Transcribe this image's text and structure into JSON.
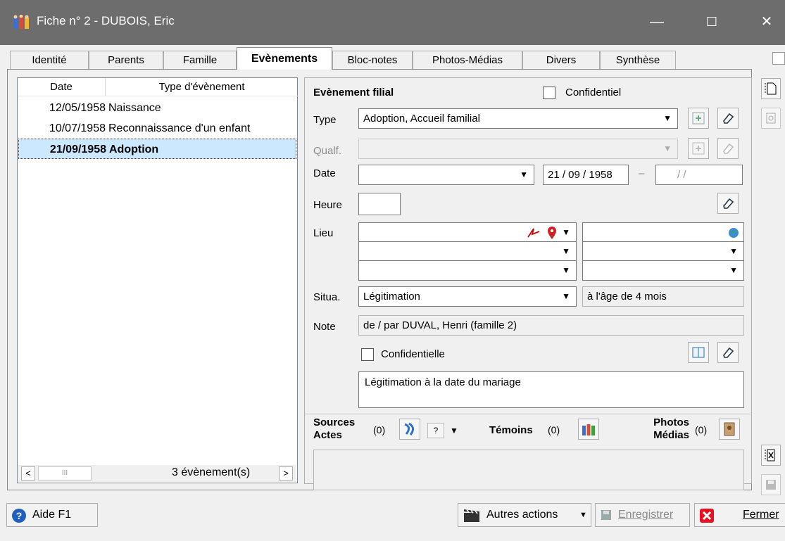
{
  "window": {
    "title": "Fiche n° 2  -  DUBOIS, Eric",
    "minimize": "—",
    "maximize": "☐",
    "close": "✕"
  },
  "tabs": [
    {
      "label": "Identité"
    },
    {
      "label": "Parents"
    },
    {
      "label": "Famille"
    },
    {
      "label": "Evènements",
      "active": true
    },
    {
      "label": "Bloc-notes"
    },
    {
      "label": "Photos-Médias"
    },
    {
      "label": "Divers"
    },
    {
      "label": "Synthèse"
    }
  ],
  "events_list": {
    "headers": {
      "date": "Date",
      "type": "Type d'évènement"
    },
    "rows": [
      {
        "date": "12/05/1958",
        "type": "Naissance"
      },
      {
        "date": "10/07/1958",
        "type": "Reconnaissance d'un enfant"
      },
      {
        "date": "21/09/1958",
        "type": "Adoption",
        "selected": true
      }
    ],
    "count_label": "3 évènement(s)",
    "scroll_left": "<",
    "scroll_right": ">",
    "scroll_thumb": "III"
  },
  "form": {
    "section_title": "Evènement filial",
    "confidentiel_label": "Confidentiel",
    "type_label": "Type",
    "type_value": "Adoption, Accueil familial",
    "qualif_label": "Qualf.",
    "qualif_value": "",
    "date_label": "Date",
    "date_qualifier": "",
    "date_value": "21 / 09 / 1958",
    "date_separator": "–",
    "date_end": "/     /",
    "heure_label": "Heure",
    "heure_value": "",
    "lieu_label": "Lieu",
    "lieu_values": [
      "",
      "",
      ""
    ],
    "lieu_right_values": [
      "",
      "",
      ""
    ],
    "situa_label": "Situa.",
    "situa_value": "Légitimation",
    "age_value": "à l'âge de 4 mois",
    "note_label": "Note",
    "note_value": "de / par  DUVAL, Henri (famille 2)",
    "confidentielle_label": "Confidentielle",
    "memo_text": "Légitimation à la date du mariage"
  },
  "sources": {
    "label_line1": "Sources",
    "label_line2": "Actes",
    "count": "(0)",
    "help": "?",
    "temoins_label": "Témoins",
    "temoins_count": "(0)",
    "photos_line1": "Photos",
    "photos_line2": "Médias",
    "photos_count": "(0)"
  },
  "bottom": {
    "aide_label": "Aide  F1",
    "autres_label": "Autres actions",
    "enregistrer_label": "Enregistrer",
    "fermer_label": "Fermer"
  },
  "colors": {
    "titlebar": "#6d6d6d",
    "selection": "#cce8ff",
    "close_red": "#e81123",
    "help_blue": "#1f5fbf"
  }
}
